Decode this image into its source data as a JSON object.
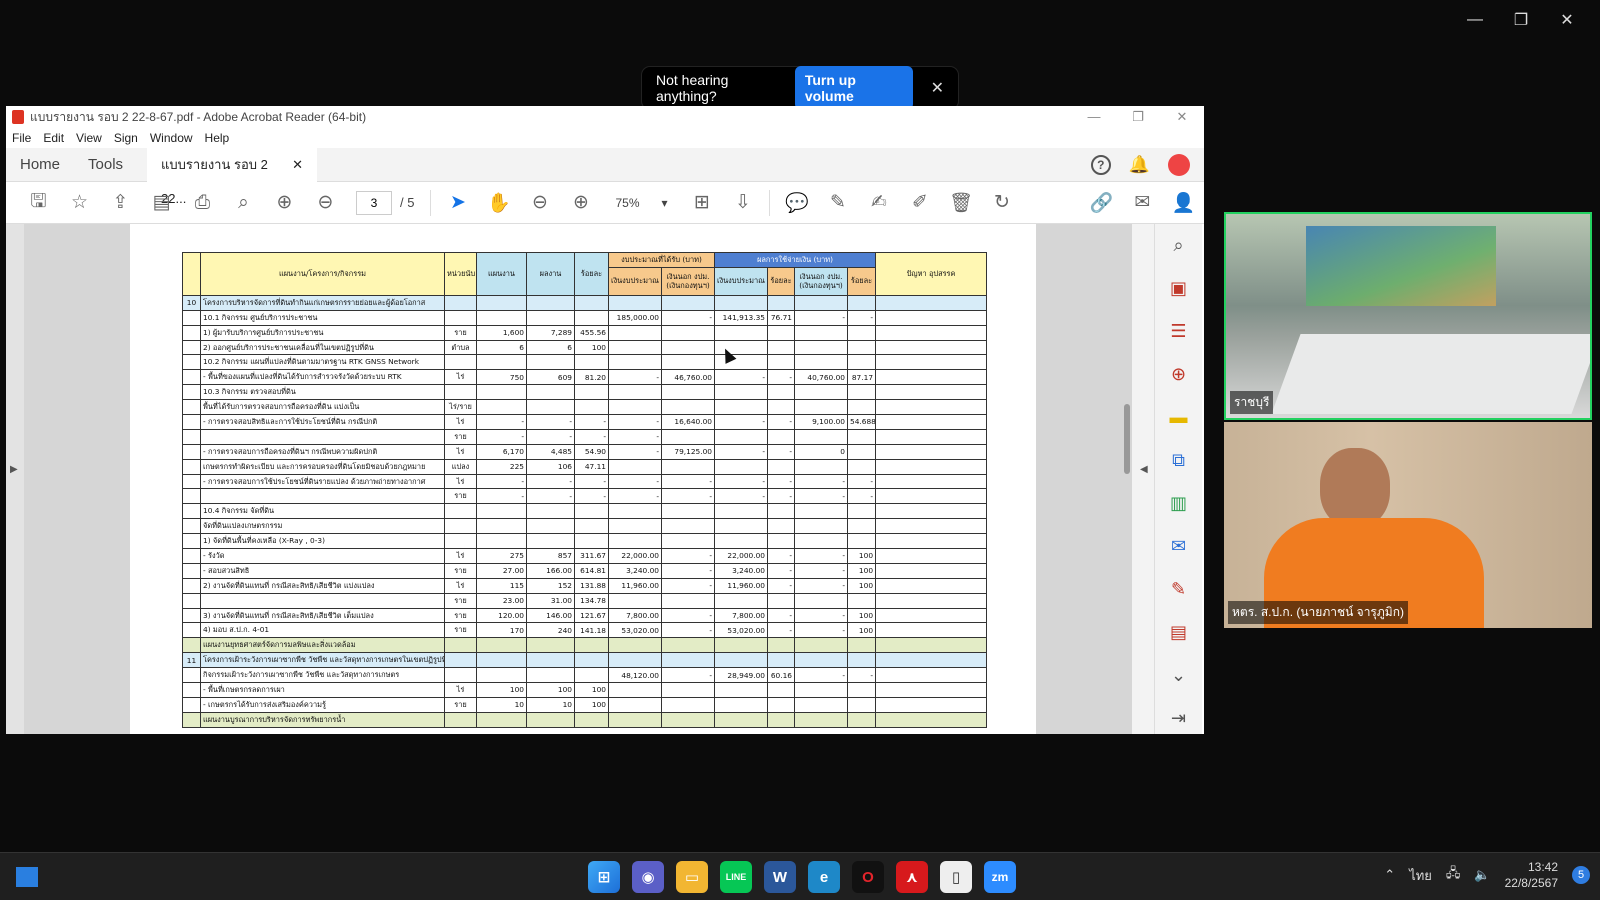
{
  "zoom_window": {
    "minimize": "—",
    "restore": "❐",
    "close": "✕"
  },
  "notice": {
    "message": "Not hearing anything?",
    "button": "Turn up volume",
    "close": "✕"
  },
  "acrobat": {
    "title": "แบบรายงาน รอบ 2 22-8-67.pdf - Adobe Acrobat Reader (64-bit)",
    "menu": [
      "File",
      "Edit",
      "View",
      "Sign",
      "Window",
      "Help"
    ],
    "tabs": {
      "home": "Home",
      "tools": "Tools",
      "doc": "แบบรายงาน รอบ 2 22...",
      "close": "✕"
    },
    "page_current": "3",
    "page_total": "/ 5",
    "zoom": "75%"
  },
  "table": {
    "header": {
      "plan": "แผนงาน/โครงการ/กิจกรรม",
      "unit": "หน่วยนับ",
      "target": "แผนงาน",
      "result": "ผลงาน",
      "percent": "ร้อยละ",
      "budget_group": "งบประมาณที่ได้รับ (บาท)",
      "spend_group": "ผลการใช้จ่ายเงิน (บาท)",
      "budget_gov": "เงินงบประมาณ",
      "budget_other": "เงินนอก งปม. (เงินกองทุนฯ)",
      "spend_gov": "เงินงบประมาณ",
      "spend_pct": "ร้อยละ",
      "spend_other": "เงินนอก งปม. (เงินกองทุนฯ)",
      "spend_pct2": "ร้อยละ",
      "issues": "ปัญหา อุปสรรค"
    },
    "rows": [
      {
        "cls": "s1",
        "no": "10",
        "name": "โครงการบริหารจัดการที่ดินทำกินแก่เกษตรกรรายย่อยและผู้ด้อยโอกาส",
        "unit": "",
        "target": "",
        "result": "",
        "pct": "",
        "bg": "",
        "bo": "",
        "sg": "",
        "sp": "",
        "so": "",
        "sp2": ""
      },
      {
        "cls": "",
        "no": "",
        "name": "10.1  กิจกรรม ศูนย์บริการประชาชน",
        "unit": "",
        "target": "",
        "result": "",
        "pct": "",
        "bg": "185,000.00",
        "bo": "-",
        "sg": "141,913.35",
        "sp": "76.71",
        "so": "-",
        "sp2": "-"
      },
      {
        "cls": "",
        "no": "",
        "name": "      1) ผู้มารับบริการศูนย์บริการประชาชน",
        "unit": "ราย",
        "target": "1,600",
        "result": "7,289",
        "pct": "455.56",
        "bg": "",
        "bo": "",
        "sg": "",
        "sp": "",
        "so": "",
        "sp2": ""
      },
      {
        "cls": "",
        "no": "",
        "name": "      2) ออกศูนย์บริการประชาชนเคลื่อนที่ในเขตปฏิรูปที่ดิน",
        "unit": "ตำบล",
        "target": "6",
        "result": "6",
        "pct": "100",
        "bg": "",
        "bo": "",
        "sg": "",
        "sp": "",
        "so": "",
        "sp2": ""
      },
      {
        "cls": "",
        "no": "",
        "name": "10.2  กิจกรรม แผนที่แปลงที่ดินตามมาตรฐาน RTK GNSS Network",
        "unit": "",
        "target": "",
        "result": "",
        "pct": "",
        "bg": "",
        "bo": "",
        "sg": "",
        "sp": "",
        "so": "",
        "sp2": ""
      },
      {
        "cls": "",
        "no": "",
        "name": "      - พื้นที่ของแผนที่แปลงที่ดินได้รับการสำรวจรังวัดด้วยระบบ RTK",
        "unit": "ไร่",
        "target": "750",
        "result": "609",
        "pct": "81.20",
        "bg": "-",
        "bo": "46,760.00",
        "sg": "-",
        "sp": "-",
        "so": "40,760.00",
        "sp2": "87.17"
      },
      {
        "cls": "",
        "no": "",
        "name": "10.3  กิจกรรม ตรวจสอบที่ดิน",
        "unit": "",
        "target": "",
        "result": "",
        "pct": "",
        "bg": "",
        "bo": "",
        "sg": "",
        "sp": "",
        "so": "",
        "sp2": ""
      },
      {
        "cls": "",
        "no": "",
        "name": "      พื้นที่ได้รับการตรวจสอบการถือครองที่ดิน แบ่งเป็น",
        "unit": "ไร่/ราย",
        "target": "",
        "result": "",
        "pct": "",
        "bg": "",
        "bo": "",
        "sg": "",
        "sp": "",
        "so": "",
        "sp2": ""
      },
      {
        "cls": "",
        "no": "",
        "name": "      - การตรวจสอบสิทธิและการใช้ประโยชน์ที่ดิน กรณีปกติ",
        "unit": "ไร่",
        "target": "-",
        "result": "-",
        "pct": "-",
        "bg": "-",
        "bo": "16,640.00",
        "sg": "-",
        "sp": "-",
        "so": "9,100.00",
        "sp2": "54.688"
      },
      {
        "cls": "",
        "no": "",
        "name": "",
        "unit": "ราย",
        "target": "-",
        "result": "-",
        "pct": "-",
        "bg": "-",
        "bo": "",
        "sg": "",
        "sp": "",
        "so": "",
        "sp2": ""
      },
      {
        "cls": "",
        "no": "",
        "name": "      - การตรวจสอบการถือครองที่ดินฯ กรณีพบความผิดปกติ",
        "unit": "ไร่",
        "target": "6,170",
        "result": "4,485",
        "pct": "54.90",
        "bg": "-",
        "bo": "79,125.00",
        "sg": "-",
        "sp": "-",
        "so": "0",
        "sp2": ""
      },
      {
        "cls": "",
        "no": "",
        "name": "        เกษตรกรทำผิดระเบียบ และการครอบครองที่ดินโดยมิชอบด้วยกฎหมาย",
        "unit": "แปลง",
        "target": "225",
        "result": "106",
        "pct": "47.11",
        "bg": "",
        "bo": "",
        "sg": "",
        "sp": "",
        "so": "",
        "sp2": ""
      },
      {
        "cls": "",
        "no": "",
        "name": "      - การตรวจสอบการใช้ประโยชน์ที่ดินรายแปลง ด้วยภาพถ่ายทางอากาศ",
        "unit": "ไร่",
        "target": "-",
        "result": "-",
        "pct": "-",
        "bg": "-",
        "bo": "-",
        "sg": "-",
        "sp": "-",
        "so": "-",
        "sp2": "-"
      },
      {
        "cls": "",
        "no": "",
        "name": "",
        "unit": "ราย",
        "target": "-",
        "result": "-",
        "pct": "-",
        "bg": "-",
        "bo": "-",
        "sg": "-",
        "sp": "-",
        "so": "-",
        "sp2": "-"
      },
      {
        "cls": "",
        "no": "",
        "name": "10.4  กิจกรรม จัดที่ดิน",
        "unit": "",
        "target": "",
        "result": "",
        "pct": "",
        "bg": "",
        "bo": "",
        "sg": "",
        "sp": "",
        "so": "",
        "sp2": ""
      },
      {
        "cls": "",
        "no": "",
        "name": "      จัดที่ดินแปลงเกษตรกรรม",
        "unit": "",
        "target": "",
        "result": "",
        "pct": "",
        "bg": "",
        "bo": "",
        "sg": "",
        "sp": "",
        "so": "",
        "sp2": ""
      },
      {
        "cls": "",
        "no": "",
        "name": "      1) จัดที่ดินพื้นที่คงเหลือ (X-Ray , 0-3)",
        "unit": "",
        "target": "",
        "result": "",
        "pct": "",
        "bg": "",
        "bo": "",
        "sg": "",
        "sp": "",
        "so": "",
        "sp2": ""
      },
      {
        "cls": "",
        "no": "",
        "name": "            - รังวัด",
        "unit": "ไร่",
        "target": "275",
        "result": "857",
        "pct": "311.67",
        "bg": "22,000.00",
        "bo": "-",
        "sg": "22,000.00",
        "sp": "-",
        "so": "-",
        "sp2": "100"
      },
      {
        "cls": "",
        "no": "",
        "name": "            - สอบสวนสิทธิ",
        "unit": "ราย",
        "target": "27.00",
        "result": "166.00",
        "pct": "614.81",
        "bg": "3,240.00",
        "bo": "-",
        "sg": "3,240.00",
        "sp": "-",
        "so": "-",
        "sp2": "100"
      },
      {
        "cls": "",
        "no": "",
        "name": "      2) งานจัดที่ดินแทนที่ กรณีสละสิทธิ/เสียชีวิต แบ่งแปลง",
        "unit": "ไร่",
        "target": "115",
        "result": "152",
        "pct": "131.88",
        "bg": "11,960.00",
        "bo": "-",
        "sg": "11,960.00",
        "sp": "-",
        "so": "-",
        "sp2": "100"
      },
      {
        "cls": "",
        "no": "",
        "name": "",
        "unit": "ราย",
        "target": "23.00",
        "result": "31.00",
        "pct": "134.78",
        "bg": "",
        "bo": "",
        "sg": "",
        "sp": "",
        "so": "",
        "sp2": ""
      },
      {
        "cls": "",
        "no": "",
        "name": "      3) งานจัดที่ดินแทนที่ กรณีสละสิทธิ/เสียชีวิต เต็มแปลง",
        "unit": "ราย",
        "target": "120.00",
        "result": "146.00",
        "pct": "121.67",
        "bg": "7,800.00",
        "bo": "-",
        "sg": "7,800.00",
        "sp": "-",
        "so": "-",
        "sp2": "100"
      },
      {
        "cls": "",
        "no": "",
        "name": "      4) มอบ ส.ป.ก. 4-01",
        "unit": "ราย",
        "target": "170",
        "result": "240",
        "pct": "141.18",
        "bg": "53,020.00",
        "bo": "-",
        "sg": "53,020.00",
        "sp": "-",
        "so": "-",
        "sp2": "100"
      },
      {
        "cls": "s2",
        "no": "",
        "name": "แผนงานยุทธศาสตร์จัดการมลพิษและสิ่งแวดล้อม",
        "unit": "",
        "target": "",
        "result": "",
        "pct": "",
        "bg": "",
        "bo": "",
        "sg": "",
        "sp": "",
        "so": "",
        "sp2": ""
      },
      {
        "cls": "s1",
        "no": "11",
        "name": "โครงการเฝ้าระวังการเผาซากพืช วัชพืช และวัสดุทางการเกษตรในเขตปฏิรูปที่ดิน",
        "unit": "",
        "target": "",
        "result": "",
        "pct": "",
        "bg": "",
        "bo": "",
        "sg": "",
        "sp": "",
        "so": "",
        "sp2": ""
      },
      {
        "cls": "",
        "no": "",
        "name": "      กิจกรรมเฝ้าระวังการเผาซากพืช วัชพืช และวัสดุทางการเกษตร",
        "unit": "",
        "target": "",
        "result": "",
        "pct": "",
        "bg": "48,120.00",
        "bo": "-",
        "sg": "28,949.00",
        "sp": "60.16",
        "so": "-",
        "sp2": "-"
      },
      {
        "cls": "",
        "no": "",
        "name": "      - พื้นที่เกษตรกรลดการเผา",
        "unit": "ไร่",
        "target": "100",
        "result": "100",
        "pct": "100",
        "bg": "",
        "bo": "",
        "sg": "",
        "sp": "",
        "so": "",
        "sp2": ""
      },
      {
        "cls": "",
        "no": "",
        "name": "      - เกษตรกรได้รับการส่งเสริมองค์ความรู้",
        "unit": "ราย",
        "target": "10",
        "result": "10",
        "pct": "100",
        "bg": "",
        "bo": "",
        "sg": "",
        "sp": "",
        "so": "",
        "sp2": ""
      },
      {
        "cls": "s2",
        "no": "",
        "name": "แผนงานบูรณาการบริหารจัดการทรัพยากรน้ำ",
        "unit": "",
        "target": "",
        "result": "",
        "pct": "",
        "bg": "",
        "bo": "",
        "sg": "",
        "sp": "",
        "so": "",
        "sp2": ""
      }
    ]
  },
  "videos": {
    "top_label": "ราชบุรี",
    "bottom_label": "หตร. ส.ป.ก. (นายภาชน์ จารุภูมิก)"
  },
  "taskbar": {
    "lang": "ไทย",
    "time": "13:42",
    "date": "22/8/2567",
    "badge": "5"
  }
}
